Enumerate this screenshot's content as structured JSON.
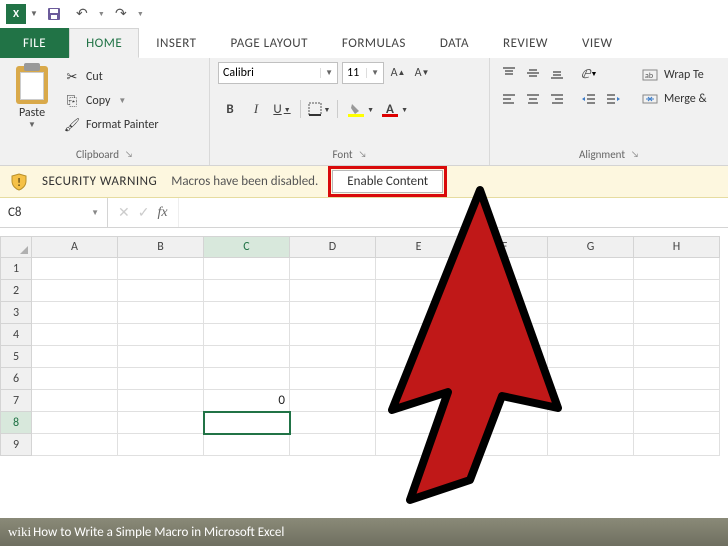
{
  "qat": {
    "app_abbrev": "X"
  },
  "tabs": {
    "file": "FILE",
    "home": "HOME",
    "insert": "INSERT",
    "page_layout": "PAGE LAYOUT",
    "formulas": "FORMULAS",
    "data": "DATA",
    "review": "REVIEW",
    "view": "VIEW"
  },
  "ribbon": {
    "clipboard": {
      "paste": "Paste",
      "cut": "Cut",
      "copy": "Copy",
      "format_painter": "Format Painter",
      "label": "Clipboard"
    },
    "font": {
      "name": "Calibri",
      "size": "11",
      "label": "Font",
      "bold": "B",
      "italic": "I",
      "underline": "U"
    },
    "alignment": {
      "label": "Alignment",
      "wrap": "Wrap Te",
      "merge": "Merge &"
    }
  },
  "security": {
    "title": "SECURITY WARNING",
    "message": "Macros have been disabled.",
    "enable": "Enable Content"
  },
  "namebox": "C8",
  "fx": "fx",
  "columns": [
    "A",
    "B",
    "C",
    "D",
    "E",
    "F",
    "G",
    "H"
  ],
  "rows": [
    "1",
    "2",
    "3",
    "4",
    "5",
    "6",
    "7",
    "8",
    "9"
  ],
  "active_cell": {
    "row": "8",
    "col": "C"
  },
  "cells": {
    "C7": "0"
  },
  "footer": {
    "wiki": "wiki",
    "title": "How to Write a Simple Macro in Microsoft Excel"
  }
}
